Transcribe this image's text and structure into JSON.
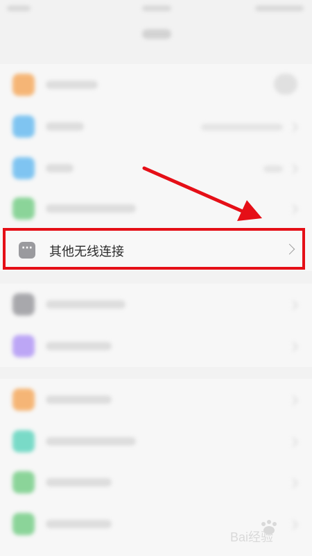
{
  "highlighted_row": {
    "label": "其他无线连接",
    "icon": "more-dots-icon",
    "icon_glyph": "···"
  },
  "colors": {
    "highlight_border": "#e50f17",
    "arrow": "#e50f17"
  },
  "watermark": {
    "text": "Bai经验"
  },
  "blurred_icon_colors": [
    "#f5a04b",
    "#58b4ef",
    "#58b4ef",
    "#67c97a",
    "#8e8e93",
    "#a98bf5",
    "#f5a04b",
    "#4fd1b8",
    "#67c97a",
    "#67c97a"
  ]
}
